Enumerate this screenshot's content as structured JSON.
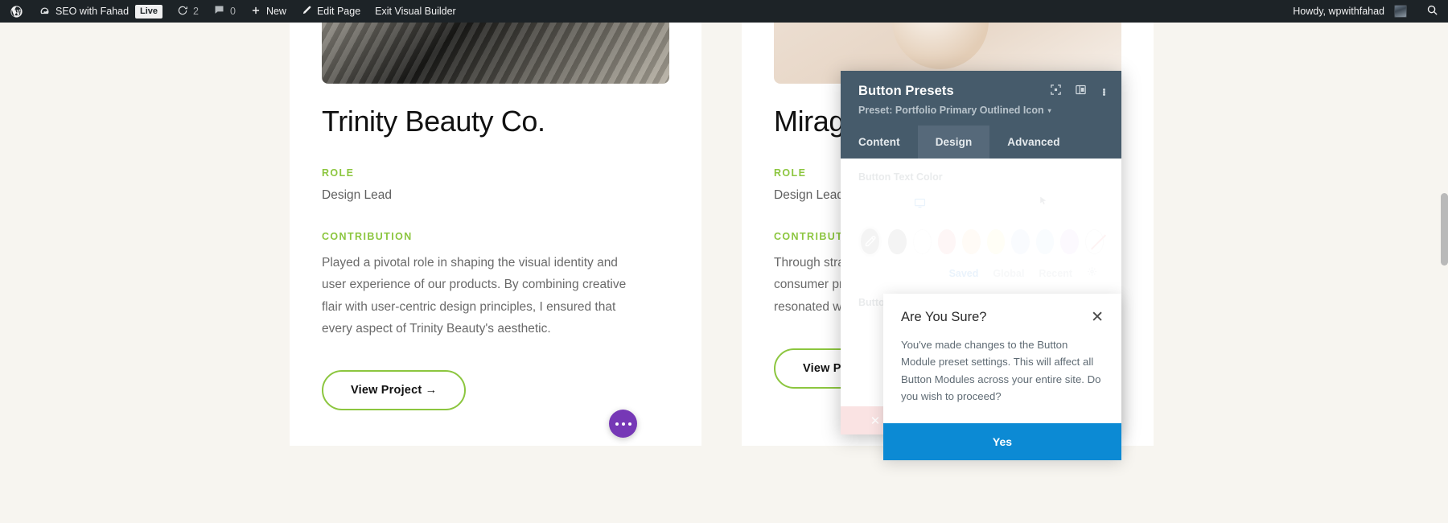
{
  "adminbar": {
    "wp_logo": "wordpress-logo-icon",
    "site_name": "SEO with Fahad",
    "site_icon": "dashboard-icon",
    "live_badge": "Live",
    "speed_icon": "speed-optimize-icon",
    "speed_count": "2",
    "comments_icon": "comment-bubble-icon",
    "comments_count": "0",
    "new_icon": "plus-icon",
    "new_label": "New",
    "edit_icon": "pencil-icon",
    "edit_label": "Edit Page",
    "exit_label": "Exit Visual Builder",
    "howdy": "Howdy, wpwithfahad",
    "avatar": "user-avatar",
    "search_icon": "search-icon"
  },
  "cards": [
    {
      "title": "Trinity Beauty Co.",
      "role_label": "ROLE",
      "role_value": "Design Lead",
      "contribution_label": "CONTRIBUTION",
      "contribution_text": "Played a pivotal role in shaping the visual identity and user experience of our products. By combining creative flair with user-centric design principles, I ensured that every aspect of Trinity Beauty's aesthetic.",
      "button_label": "View Project →"
    },
    {
      "title": "Mirage Candle",
      "role_label": "ROLE",
      "role_value": "Design Lead",
      "contribution_label": "CONTRIBUTION",
      "contribution_text": "Through strategic design decis understanding of consumer pr visually compelling packaging, designs that resonated with th",
      "button_label": "View Project →"
    }
  ],
  "fab": {
    "icon": "ellipsis-icon"
  },
  "modal": {
    "title": "Button Presets",
    "preset_label": "Preset: Portfolio Primary Outlined Icon",
    "caret": "▾",
    "header_icons": {
      "focus": "focus-target-icon",
      "layout": "panel-layout-icon",
      "more": "kebab-menu-icon"
    },
    "tabs": [
      {
        "label": "Content",
        "active": false
      },
      {
        "label": "Design",
        "active": true
      },
      {
        "label": "Advanced",
        "active": false
      }
    ],
    "fields": {
      "text_color_label": "Button Text Color",
      "background_label": "Button Background"
    },
    "device_icons": {
      "desktop": "desktop-monitor-icon",
      "hover": "cursor-pointer-icon"
    },
    "swatches": [
      {
        "name": "eyedropper",
        "color": "#8f8f8f"
      },
      {
        "name": "gray",
        "color": "#8c8c8c"
      },
      {
        "name": "white",
        "color": "#ffffff"
      },
      {
        "name": "red",
        "color": "#f4a6a6"
      },
      {
        "name": "orange",
        "color": "#f7d7a0"
      },
      {
        "name": "yellow",
        "color": "#f7f2a0"
      },
      {
        "name": "blue",
        "color": "#c2d3f2"
      },
      {
        "name": "lightblue",
        "color": "#bcdaf0"
      },
      {
        "name": "purple",
        "color": "#ddbdf2"
      },
      {
        "name": "none",
        "color": "#ffffff"
      }
    ],
    "color_sources": [
      {
        "label": "Saved",
        "active": true
      },
      {
        "label": "Global",
        "active": false
      },
      {
        "label": "Recent",
        "active": false
      }
    ],
    "gear_icon": "gear-icon",
    "overflow_dots": "•••"
  },
  "confirm": {
    "title": "Are You Sure?",
    "close_icon": "✕",
    "body": "You've made changes to the Button Module preset settings. This will affect all Button Modules across your entire site. Do you wish to proceed?",
    "yes_label": "Yes"
  },
  "colors": {
    "accent_green": "#8cc63f",
    "modal_header": "#465b6b",
    "primary_blue": "#0c8ad4",
    "fab_purple": "#7638b6"
  }
}
